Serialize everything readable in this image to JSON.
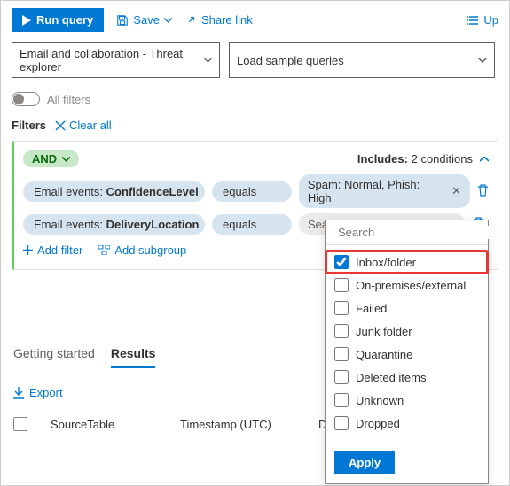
{
  "toolbar": {
    "run_label": "Run query",
    "save_label": "Save",
    "share_label": "Share link",
    "up_label": "Up"
  },
  "dropdowns": {
    "scope": "Email and collaboration - Threat explorer",
    "sample": "Load sample queries"
  },
  "filters": {
    "all_filters_label": "All filters",
    "title": "Filters",
    "clear_all": "Clear all",
    "and_label": "AND",
    "includes_prefix": "Includes:",
    "includes_value": "2 conditions",
    "rows": [
      {
        "field_prefix": "Email events:",
        "field": "ConfidenceLevel",
        "op": "equals",
        "value": "Spam: Normal, Phish: High"
      },
      {
        "field_prefix": "Email events:",
        "field": "DeliveryLocation",
        "op": "equals",
        "value_placeholder": "Search"
      }
    ],
    "add_filter": "Add filter",
    "add_subgroup": "Add subgroup"
  },
  "popover": {
    "search_placeholder": "Search",
    "options": [
      "Inbox/folder",
      "On-premises/external",
      "Failed",
      "Junk folder",
      "Quarantine",
      "Deleted items",
      "Unknown",
      "Dropped"
    ],
    "selected_index": 0,
    "apply": "Apply"
  },
  "tabs": {
    "getting_started": "Getting started",
    "results": "Results"
  },
  "export_label": "Export",
  "table": {
    "col1": "SourceTable",
    "col2": "Timestamp (UTC)",
    "col3": "DeviceId"
  }
}
